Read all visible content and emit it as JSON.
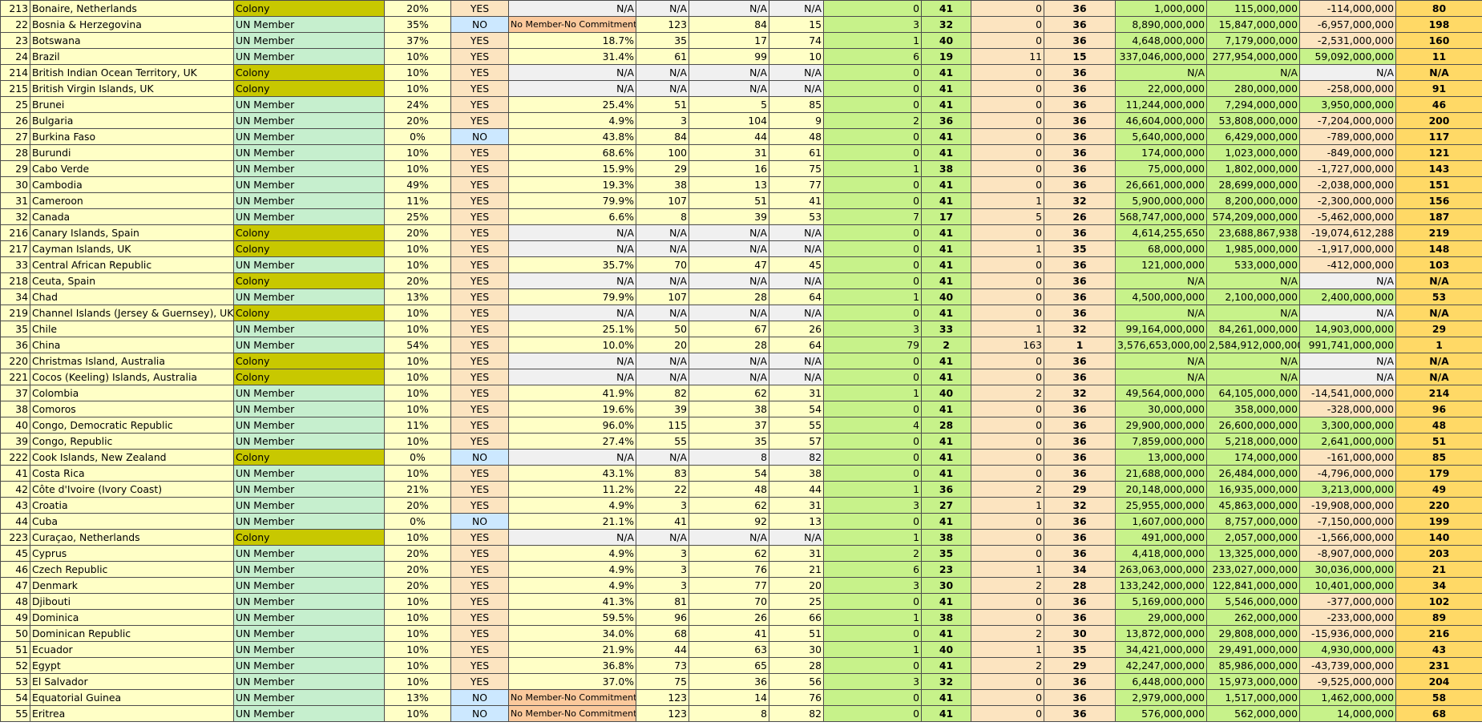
{
  "sheet": {
    "rows": [
      [
        "213",
        "Bonaire, Netherlands",
        "Colony",
        "20%",
        "YES",
        "N/A",
        "N/A",
        "N/A",
        "N/A",
        "0",
        "41",
        "0",
        "36",
        "1,000,000",
        "115,000,000",
        "-114,000,000",
        "80"
      ],
      [
        "22",
        "Bosnia & Herzegovina",
        "UN Member",
        "35%",
        "NO",
        "No Member-No Commitment",
        "123",
        "84",
        "15",
        "3",
        "32",
        "0",
        "36",
        "8,890,000,000",
        "15,847,000,000",
        "-6,957,000,000",
        "198"
      ],
      [
        "23",
        "Botswana",
        "UN Member",
        "37%",
        "YES",
        "18.7%",
        "35",
        "17",
        "74",
        "1",
        "40",
        "0",
        "36",
        "4,648,000,000",
        "7,179,000,000",
        "-2,531,000,000",
        "160"
      ],
      [
        "24",
        "Brazil",
        "UN Member",
        "10%",
        "YES",
        "31.4%",
        "61",
        "99",
        "10",
        "6",
        "19",
        "11",
        "15",
        "337,046,000,000",
        "277,954,000,000",
        "59,092,000,000",
        "11"
      ],
      [
        "214",
        "British Indian Ocean Territory, UK",
        "Colony",
        "10%",
        "YES",
        "N/A",
        "N/A",
        "N/A",
        "N/A",
        "0",
        "41",
        "0",
        "36",
        "N/A",
        "N/A",
        "N/A",
        "N/A"
      ],
      [
        "215",
        "British Virgin Islands, UK",
        "Colony",
        "10%",
        "YES",
        "N/A",
        "N/A",
        "N/A",
        "N/A",
        "0",
        "41",
        "0",
        "36",
        "22,000,000",
        "280,000,000",
        "-258,000,000",
        "91"
      ],
      [
        "25",
        "Brunei",
        "UN Member",
        "24%",
        "YES",
        "25.4%",
        "51",
        "5",
        "85",
        "0",
        "41",
        "0",
        "36",
        "11,244,000,000",
        "7,294,000,000",
        "3,950,000,000",
        "46"
      ],
      [
        "26",
        "Bulgaria",
        "UN Member",
        "20%",
        "YES",
        "4.9%",
        "3",
        "104",
        "9",
        "2",
        "36",
        "0",
        "36",
        "46,604,000,000",
        "53,808,000,000",
        "-7,204,000,000",
        "200"
      ],
      [
        "27",
        "Burkina Faso",
        "UN Member",
        "0%",
        "NO",
        "43.8%",
        "84",
        "44",
        "48",
        "0",
        "41",
        "0",
        "36",
        "5,640,000,000",
        "6,429,000,000",
        "-789,000,000",
        "117"
      ],
      [
        "28",
        "Burundi",
        "UN Member",
        "10%",
        "YES",
        "68.6%",
        "100",
        "31",
        "61",
        "0",
        "41",
        "0",
        "36",
        "174,000,000",
        "1,023,000,000",
        "-849,000,000",
        "121"
      ],
      [
        "29",
        "Cabo Verde",
        "UN Member",
        "10%",
        "YES",
        "15.9%",
        "29",
        "16",
        "75",
        "1",
        "38",
        "0",
        "36",
        "75,000,000",
        "1,802,000,000",
        "-1,727,000,000",
        "143"
      ],
      [
        "30",
        "Cambodia",
        "UN Member",
        "49%",
        "YES",
        "19.3%",
        "38",
        "13",
        "77",
        "0",
        "41",
        "0",
        "36",
        "26,661,000,000",
        "28,699,000,000",
        "-2,038,000,000",
        "151"
      ],
      [
        "31",
        "Cameroon",
        "UN Member",
        "11%",
        "YES",
        "79.9%",
        "107",
        "51",
        "41",
        "0",
        "41",
        "1",
        "32",
        "5,900,000,000",
        "8,200,000,000",
        "-2,300,000,000",
        "156"
      ],
      [
        "32",
        "Canada",
        "UN Member",
        "25%",
        "YES",
        "6.6%",
        "8",
        "39",
        "53",
        "7",
        "17",
        "5",
        "26",
        "568,747,000,000",
        "574,209,000,000",
        "-5,462,000,000",
        "187"
      ],
      [
        "216",
        "Canary Islands, Spain",
        "Colony",
        "20%",
        "YES",
        "N/A",
        "N/A",
        "N/A",
        "N/A",
        "0",
        "41",
        "0",
        "36",
        "4,614,255,650",
        "23,688,867,938",
        "-19,074,612,288",
        "219"
      ],
      [
        "217",
        "Cayman Islands, UK",
        "Colony",
        "10%",
        "YES",
        "N/A",
        "N/A",
        "N/A",
        "N/A",
        "0",
        "41",
        "1",
        "35",
        "68,000,000",
        "1,985,000,000",
        "-1,917,000,000",
        "148"
      ],
      [
        "33",
        "Central African Republic",
        "UN Member",
        "10%",
        "YES",
        "35.7%",
        "70",
        "47",
        "45",
        "0",
        "41",
        "0",
        "36",
        "121,000,000",
        "533,000,000",
        "-412,000,000",
        "103"
      ],
      [
        "218",
        "Ceuta, Spain",
        "Colony",
        "20%",
        "YES",
        "N/A",
        "N/A",
        "N/A",
        "N/A",
        "0",
        "41",
        "0",
        "36",
        "N/A",
        "N/A",
        "N/A",
        "N/A"
      ],
      [
        "34",
        "Chad",
        "UN Member",
        "13%",
        "YES",
        "79.9%",
        "107",
        "28",
        "64",
        "1",
        "40",
        "0",
        "36",
        "4,500,000,000",
        "2,100,000,000",
        "2,400,000,000",
        "53"
      ],
      [
        "219",
        "Channel Islands (Jersey & Guernsey), UK",
        "Colony",
        "10%",
        "YES",
        "N/A",
        "N/A",
        "N/A",
        "N/A",
        "0",
        "41",
        "0",
        "36",
        "N/A",
        "N/A",
        "N/A",
        "N/A"
      ],
      [
        "35",
        "Chile",
        "UN Member",
        "10%",
        "YES",
        "25.1%",
        "50",
        "67",
        "26",
        "3",
        "33",
        "1",
        "32",
        "99,164,000,000",
        "84,261,000,000",
        "14,903,000,000",
        "29"
      ],
      [
        "36",
        "China",
        "UN Member",
        "54%",
        "YES",
        "10.0%",
        "20",
        "28",
        "64",
        "79",
        "2",
        "163",
        "1",
        "3,576,653,000,000",
        "2,584,912,000,000",
        "991,741,000,000",
        "1"
      ],
      [
        "220",
        "Christmas Island, Australia",
        "Colony",
        "10%",
        "YES",
        "N/A",
        "N/A",
        "N/A",
        "N/A",
        "0",
        "41",
        "0",
        "36",
        "N/A",
        "N/A",
        "N/A",
        "N/A"
      ],
      [
        "221",
        "Cocos (Keeling) Islands, Australia",
        "Colony",
        "10%",
        "YES",
        "N/A",
        "N/A",
        "N/A",
        "N/A",
        "0",
        "41",
        "0",
        "36",
        "N/A",
        "N/A",
        "N/A",
        "N/A"
      ],
      [
        "37",
        "Colombia",
        "UN Member",
        "10%",
        "YES",
        "41.9%",
        "82",
        "62",
        "31",
        "1",
        "40",
        "2",
        "32",
        "49,564,000,000",
        "64,105,000,000",
        "-14,541,000,000",
        "214"
      ],
      [
        "38",
        "Comoros",
        "UN Member",
        "10%",
        "YES",
        "19.6%",
        "39",
        "38",
        "54",
        "0",
        "41",
        "0",
        "36",
        "30,000,000",
        "358,000,000",
        "-328,000,000",
        "96"
      ],
      [
        "40",
        "Congo, Democratic Republic",
        "UN Member",
        "11%",
        "YES",
        "96.0%",
        "115",
        "37",
        "55",
        "4",
        "28",
        "0",
        "36",
        "29,900,000,000",
        "26,600,000,000",
        "3,300,000,000",
        "48"
      ],
      [
        "39",
        "Congo, Republic",
        "UN Member",
        "10%",
        "YES",
        "27.4%",
        "55",
        "35",
        "57",
        "0",
        "41",
        "0",
        "36",
        "7,859,000,000",
        "5,218,000,000",
        "2,641,000,000",
        "51"
      ],
      [
        "222",
        "Cook Islands, New Zealand",
        "Colony",
        "0%",
        "NO",
        "N/A",
        "N/A",
        "8",
        "82",
        "0",
        "41",
        "0",
        "36",
        "13,000,000",
        "174,000,000",
        "-161,000,000",
        "85"
      ],
      [
        "41",
        "Costa Rica",
        "UN Member",
        "10%",
        "YES",
        "43.1%",
        "83",
        "54",
        "38",
        "0",
        "41",
        "0",
        "36",
        "21,688,000,000",
        "26,484,000,000",
        "-4,796,000,000",
        "179"
      ],
      [
        "42",
        "Côte d'Ivoire (Ivory Coast)",
        "UN Member",
        "21%",
        "YES",
        "11.2%",
        "22",
        "48",
        "44",
        "1",
        "36",
        "2",
        "29",
        "20,148,000,000",
        "16,935,000,000",
        "3,213,000,000",
        "49"
      ],
      [
        "43",
        "Croatia",
        "UN Member",
        "20%",
        "YES",
        "4.9%",
        "3",
        "62",
        "31",
        "3",
        "27",
        "1",
        "32",
        "25,955,000,000",
        "45,863,000,000",
        "-19,908,000,000",
        "220"
      ],
      [
        "44",
        "Cuba",
        "UN Member",
        "0%",
        "NO",
        "21.1%",
        "41",
        "92",
        "13",
        "0",
        "41",
        "0",
        "36",
        "1,607,000,000",
        "8,757,000,000",
        "-7,150,000,000",
        "199"
      ],
      [
        "223",
        "Curaçao, Netherlands",
        "Colony",
        "10%",
        "YES",
        "N/A",
        "N/A",
        "N/A",
        "N/A",
        "1",
        "38",
        "0",
        "36",
        "491,000,000",
        "2,057,000,000",
        "-1,566,000,000",
        "140"
      ],
      [
        "45",
        "Cyprus",
        "UN Member",
        "20%",
        "YES",
        "4.9%",
        "3",
        "62",
        "31",
        "2",
        "35",
        "0",
        "36",
        "4,418,000,000",
        "13,325,000,000",
        "-8,907,000,000",
        "203"
      ],
      [
        "46",
        "Czech Republic",
        "UN Member",
        "20%",
        "YES",
        "4.9%",
        "3",
        "76",
        "21",
        "6",
        "23",
        "1",
        "34",
        "263,063,000,000",
        "233,027,000,000",
        "30,036,000,000",
        "21"
      ],
      [
        "47",
        "Denmark",
        "UN Member",
        "20%",
        "YES",
        "4.9%",
        "3",
        "77",
        "20",
        "3",
        "30",
        "2",
        "28",
        "133,242,000,000",
        "122,841,000,000",
        "10,401,000,000",
        "34"
      ],
      [
        "48",
        "Djibouti",
        "UN Member",
        "10%",
        "YES",
        "41.3%",
        "81",
        "70",
        "25",
        "0",
        "41",
        "0",
        "36",
        "5,169,000,000",
        "5,546,000,000",
        "-377,000,000",
        "102"
      ],
      [
        "49",
        "Dominica",
        "UN Member",
        "10%",
        "YES",
        "59.5%",
        "96",
        "26",
        "66",
        "1",
        "38",
        "0",
        "36",
        "29,000,000",
        "262,000,000",
        "-233,000,000",
        "89"
      ],
      [
        "50",
        "Dominican Republic",
        "UN Member",
        "10%",
        "YES",
        "34.0%",
        "68",
        "41",
        "51",
        "0",
        "41",
        "2",
        "30",
        "13,872,000,000",
        "29,808,000,000",
        "-15,936,000,000",
        "216"
      ],
      [
        "51",
        "Ecuador",
        "UN Member",
        "10%",
        "YES",
        "21.9%",
        "44",
        "63",
        "30",
        "1",
        "40",
        "1",
        "35",
        "34,421,000,000",
        "29,491,000,000",
        "4,930,000,000",
        "43"
      ],
      [
        "52",
        "Egypt",
        "UN Member",
        "10%",
        "YES",
        "36.8%",
        "73",
        "65",
        "28",
        "0",
        "41",
        "2",
        "29",
        "42,247,000,000",
        "85,986,000,000",
        "-43,739,000,000",
        "231"
      ],
      [
        "53",
        "El Salvador",
        "UN Member",
        "10%",
        "YES",
        "37.0%",
        "75",
        "36",
        "56",
        "3",
        "32",
        "0",
        "36",
        "6,448,000,000",
        "15,973,000,000",
        "-9,525,000,000",
        "204"
      ],
      [
        "54",
        "Equatorial Guinea",
        "UN Member",
        "13%",
        "NO",
        "No Member-No Commitment",
        "123",
        "14",
        "76",
        "0",
        "41",
        "0",
        "36",
        "2,979,000,000",
        "1,517,000,000",
        "1,462,000,000",
        "58"
      ],
      [
        "55",
        "Eritrea",
        "UN Member",
        "10%",
        "NO",
        "No Member-No Commitment",
        "123",
        "8",
        "82",
        "0",
        "41",
        "0",
        "36",
        "576,000,000",
        "562,000,000",
        "14,000,000",
        "68"
      ]
    ]
  }
}
